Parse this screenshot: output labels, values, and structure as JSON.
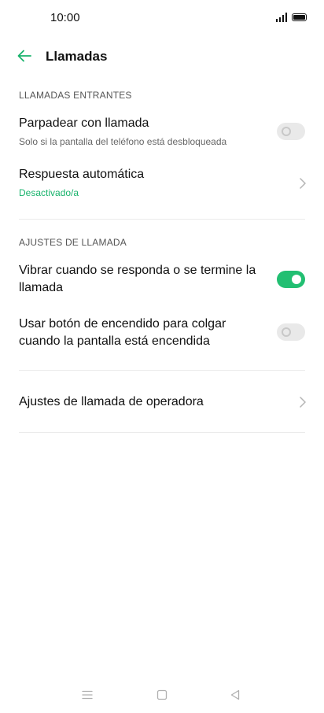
{
  "status_bar": {
    "time": "10:00"
  },
  "header": {
    "title": "Llamadas"
  },
  "sections": {
    "incoming": {
      "header": "LLAMADAS ENTRANTES",
      "flash": {
        "title": "Parpadear con llamada",
        "subtitle": "Solo si la pantalla del teléfono está desbloqueada",
        "enabled": false
      },
      "auto_answer": {
        "title": "Respuesta automática",
        "value": "Desactivado/a"
      }
    },
    "call_settings": {
      "header": "AJUSTES DE LLAMADA",
      "vibrate": {
        "title": "Vibrar cuando se responda o se termine la llamada",
        "enabled": true
      },
      "power_end": {
        "title": "Usar botón de encendido para colgar cuando la pantalla está encendida",
        "enabled": false
      }
    },
    "operator": {
      "title": "Ajustes de llamada de operadora"
    }
  },
  "colors": {
    "accent": "#18b36c",
    "toggle_on": "#22bf72",
    "toggle_off": "#e9e9e9"
  }
}
